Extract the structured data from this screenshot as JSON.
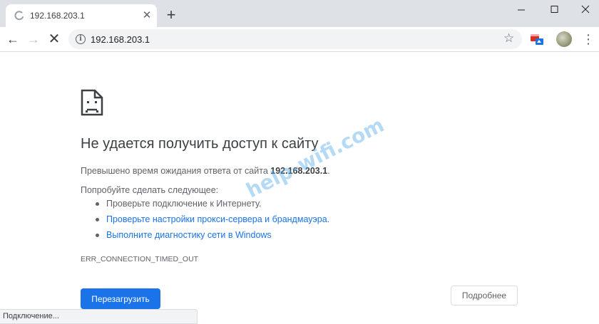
{
  "tab": {
    "title": "192.168.203.1",
    "close_glyph": "✕",
    "spinner_icon": "loading-spinner-icon"
  },
  "new_tab_glyph": "+",
  "window_controls": {
    "minimize_icon": "minimize-icon",
    "maximize_icon": "maximize-icon",
    "close_icon": "close-icon"
  },
  "toolbar": {
    "back_glyph": "←",
    "forward_glyph": "→",
    "stop_glyph": "✕",
    "url": "192.168.203.1",
    "info_glyph": "i",
    "star_glyph": "☆",
    "menu_glyph": "⋮"
  },
  "error": {
    "icon": "sad-page-icon",
    "title": "Не удается получить доступ к сайту",
    "body_prefix": "Превышено время ожидания ответа от сайта ",
    "body_host": "192.168.203.1",
    "body_suffix": ".",
    "try_text": "Попробуйте сделать следующее:",
    "suggestions": [
      "Проверьте подключение к Интернету.",
      "Проверьте настройки прокси-сервера и брандмауэра.",
      "Выполните диагностику сети в Windows"
    ],
    "code": "ERR_CONNECTION_TIMED_OUT",
    "reload_label": "Перезагрузить",
    "details_label": "Подробнее"
  },
  "watermark": "help-wifi.com",
  "status": "Подключение...",
  "colors": {
    "accent": "#1a73e8",
    "titlebar": "#dee1e6",
    "text": "#3c4043",
    "secondary_text": "#5f6368"
  }
}
